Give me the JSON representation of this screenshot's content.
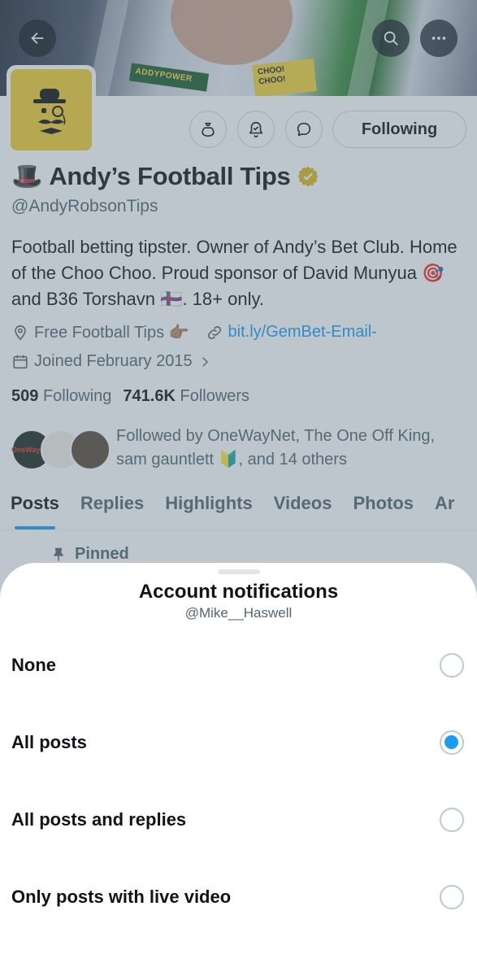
{
  "profile": {
    "banner": {
      "sponsor_text": "ADDYPOWER",
      "sign_text": "CHOO! CHOO!"
    },
    "display_name": "Andy’s Football Tips",
    "name_emoji": "🎩",
    "handle": "@AndyRobsonTips",
    "following_label": "Following",
    "bio": "Football betting tipster. Owner of Andy’s Bet Club. Home of the Choo Choo. Proud sponsor of David Munyua 🎯 and B36 Torshavn 🇫🇴. 18+ only.",
    "location": "Free Football Tips 👉🏽",
    "link": "bit.ly/GemBet-Email-",
    "joined": "Joined February 2015",
    "following_count": "509",
    "following_word": "Following",
    "followers_count": "741.6K",
    "followers_word": "Followers",
    "followed_by": "Followed by OneWayNet, The One Off King, sam gauntlett 🔰, and 14 others",
    "follower_avatar_text": "OneWayNet"
  },
  "tabs": [
    {
      "label": "Posts",
      "active": true
    },
    {
      "label": "Replies",
      "active": false
    },
    {
      "label": "Highlights",
      "active": false
    },
    {
      "label": "Videos",
      "active": false
    },
    {
      "label": "Photos",
      "active": false
    },
    {
      "label": "Ar",
      "active": false
    }
  ],
  "pinned_label": "Pinned",
  "icons": {
    "back": "back-arrow-icon",
    "search": "search-icon",
    "more": "more-icon",
    "tip": "money-bag-icon",
    "notify": "bell-check-icon",
    "message": "chat-bubble-icon",
    "verified": "verified-badge-icon",
    "location": "location-pin-icon",
    "link": "link-icon",
    "calendar": "calendar-icon",
    "pin": "pin-icon"
  },
  "colors": {
    "accent": "#1d9bf0",
    "verified": "#e2b719",
    "avatar_bg": "#f2cd2f"
  },
  "sheet": {
    "title": "Account notifications",
    "subtitle": "@Mike__Haswell",
    "options": [
      {
        "label": "None",
        "selected": false
      },
      {
        "label": "All posts",
        "selected": true
      },
      {
        "label": "All posts and replies",
        "selected": false
      },
      {
        "label": "Only posts with live video",
        "selected": false
      }
    ]
  }
}
